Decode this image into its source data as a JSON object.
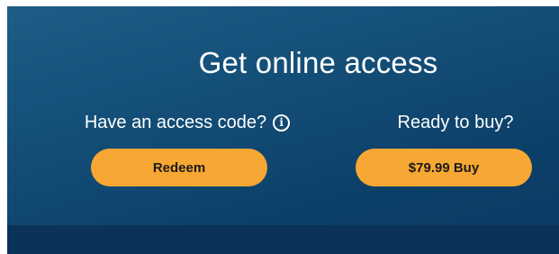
{
  "title": "Get online access",
  "access_code": {
    "prompt": "Have an access code?",
    "info_icon": "info-icon",
    "button_label": "Redeem"
  },
  "purchase": {
    "prompt": "Ready to buy?",
    "button_label": "$79.99 Buy"
  },
  "colors": {
    "panel_top": "#1e5d86",
    "panel_bottom": "#0a3a63",
    "button": "#f7a733",
    "footer_strip": "#0b3258"
  }
}
